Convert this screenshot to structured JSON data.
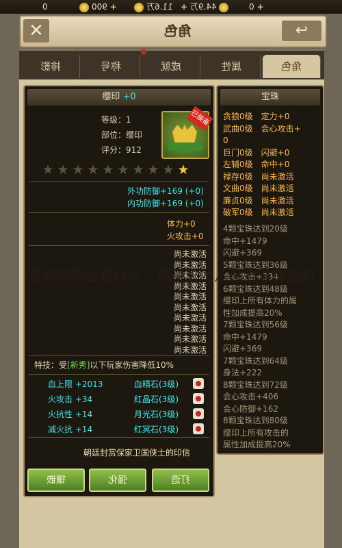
{
  "topbar": {
    "res1_value": "0",
    "res2_value": "900",
    "res3_value": "11.6万",
    "res4_value": "44.9万",
    "res5_value": "0",
    "plus": "+"
  },
  "header": {
    "title": "角色",
    "close_icon": "close-icon",
    "back_icon": "back-arrow-icon"
  },
  "tabs": [
    "角色",
    "属性",
    "成就",
    "称号",
    "排影"
  ],
  "item": {
    "name": "缨印",
    "level_tag": "+0",
    "grade_label": "等级：",
    "grade_value": "1",
    "part_label": "部位：",
    "part_value": "缨印",
    "score_label": "评分：",
    "score_value": "912",
    "equipped_badge": "已装备",
    "stars_total": 10,
    "stars_lit": 1,
    "stats": [
      "外功防御+169 (+0)",
      "内功防御+169 (+0)"
    ],
    "refine": [
      "体力+0",
      "火攻击+0"
    ],
    "inactive_slots": [
      "尚未激活",
      "尚未激活",
      "尚未激活",
      "尚未激活",
      "尚未激活",
      "尚未激活",
      "尚未激活",
      "尚未激活",
      "尚未激活",
      "尚未激活"
    ],
    "special": {
      "prefix": "特技：",
      "text1": "受",
      "tag": "[新秀]",
      "text2": "以下玩家伤害降低10%"
    },
    "gems": [
      {
        "name": "血精石(3级)",
        "stat": "血上限 +2013"
      },
      {
        "name": "红晶石(3级)",
        "stat": "火攻击 +34"
      },
      {
        "name": "月光石(3级)",
        "stat": "火抗性 +14"
      },
      {
        "name": "红冥石(3级)",
        "stat": "减火抗 +14"
      }
    ],
    "source": "朝廷封赏保家卫国侠士的印信"
  },
  "buttons": {
    "inlay": "镶嵌",
    "enhance": "强化",
    "forge": "打造"
  },
  "treasure": {
    "title": "宝珠",
    "active": [
      "贪狼0级　定力+0",
      "武曲0级　会心攻击+",
      "0",
      "巨门0级　闪避+0",
      "左辅0级　命中+0",
      "禄存0级　尚未激活",
      "文曲0级　尚未激活",
      "廉贞0级　尚未激活",
      "破军0级　尚未激活"
    ],
    "locked": [
      "4颗宝珠达到20级",
      "命中+1479",
      "闪避+369",
      "5颗宝珠达到36级",
      "会心攻击+334",
      "6颗宝珠达到48级",
      "缨印上所有体力的属",
      "性加成提高20%",
      "7颗宝珠达到56级",
      "命中+1479",
      "闪避+369",
      "7颗宝珠达到64级",
      "身法+222",
      "8颗宝珠达到72级",
      "会心攻击+406",
      "会心防御+162",
      "8颗宝珠达到80级",
      "缨印上所有攻击的",
      "属性加成提高20%"
    ]
  },
  "watermark": "宝珠的职业是什么？揭秘天龙八部宝珠背后的"
}
